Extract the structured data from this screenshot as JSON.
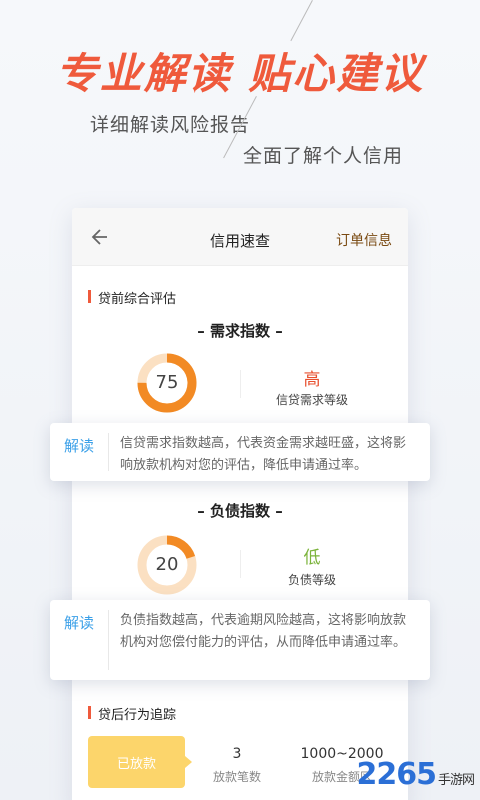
{
  "headline": "专业解读  贴心建议",
  "subtitle_1": "详细解读风险报告",
  "subtitle_2": "全面了解个人信用",
  "topbar": {
    "title": "信用速查",
    "action": "订单信息"
  },
  "section_pre": "贷前综合评估",
  "demand": {
    "title": "– 需求指数 –",
    "value": "75",
    "progress": 0.75,
    "level": "高",
    "level_label": "信贷需求等级",
    "level_color": "#e8502f"
  },
  "tip1": {
    "tag": "解读",
    "text": "信贷需求指数越高，代表资金需求越旺盛，这将影响放款机构对您的评估，降低申请通过率。"
  },
  "debt": {
    "title": "– 负债指数 –",
    "value": "20",
    "progress": 0.2,
    "level": "低",
    "level_label": "负债等级",
    "level_color": "#7bb33a"
  },
  "tip2": {
    "tag": "解读",
    "text": "负债指数越高，代表逾期风险越高，这将影响放款机构对您偿付能力的评估，从而降低申请通过率。"
  },
  "section_post": "贷后行为追踪",
  "post": {
    "button": "已放款",
    "count_value": "3",
    "count_label": "放款笔数",
    "amount_value": "1000~2000",
    "amount_label": "放款金额区"
  },
  "watermark": {
    "text": "2265",
    "suffix": "手游网"
  },
  "colors": {
    "accent": "#ef5a3c",
    "ring_orange": "#f28a24",
    "ring_track": "#fbe0c2",
    "tip_blue": "#3ba0e8"
  }
}
